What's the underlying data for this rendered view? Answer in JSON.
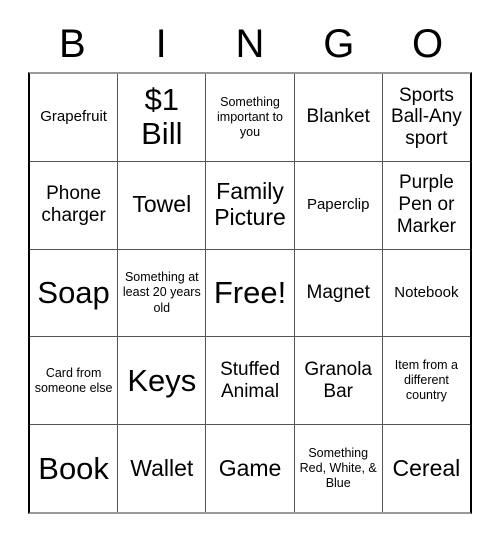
{
  "card": {
    "header": {
      "letters": [
        "B",
        "I",
        "N",
        "G",
        "O"
      ]
    },
    "rows": [
      {
        "cells": [
          {
            "text": "Grapefruit",
            "size": "sz-s"
          },
          {
            "text": "$1 Bill",
            "size": "sz-xl"
          },
          {
            "text": "Something important to you",
            "size": "sz-xs"
          },
          {
            "text": "Blanket",
            "size": "sz-m"
          },
          {
            "text": "Sports Ball-Any sport",
            "size": "sz-m"
          }
        ]
      },
      {
        "cells": [
          {
            "text": "Phone charger",
            "size": "sz-m"
          },
          {
            "text": "Towel",
            "size": "sz-l"
          },
          {
            "text": "Family Picture",
            "size": "sz-l"
          },
          {
            "text": "Paperclip",
            "size": "sz-s"
          },
          {
            "text": "Purple Pen or Marker",
            "size": "sz-m"
          }
        ]
      },
      {
        "cells": [
          {
            "text": "Soap",
            "size": "sz-xl"
          },
          {
            "text": "Something at least 20 years old",
            "size": "sz-xs"
          },
          {
            "text": "Free!",
            "size": "sz-xl"
          },
          {
            "text": "Magnet",
            "size": "sz-m"
          },
          {
            "text": "Notebook",
            "size": "sz-s"
          }
        ]
      },
      {
        "cells": [
          {
            "text": "Card from someone else",
            "size": "sz-xs"
          },
          {
            "text": "Keys",
            "size": "sz-xl"
          },
          {
            "text": "Stuffed Animal",
            "size": "sz-m"
          },
          {
            "text": "Granola Bar",
            "size": "sz-m"
          },
          {
            "text": "Item from a different country",
            "size": "sz-xs"
          }
        ]
      },
      {
        "cells": [
          {
            "text": "Book",
            "size": "sz-xl"
          },
          {
            "text": "Wallet",
            "size": "sz-l"
          },
          {
            "text": "Game",
            "size": "sz-l"
          },
          {
            "text": "Something Red, White, & Blue",
            "size": "sz-xs"
          },
          {
            "text": "Cereal",
            "size": "sz-l"
          }
        ]
      }
    ]
  },
  "colors": {
    "background": "#ffffff",
    "text": "#000000",
    "outer_border": "#000000",
    "inner_border": "#555555",
    "top_border": "#999999"
  }
}
